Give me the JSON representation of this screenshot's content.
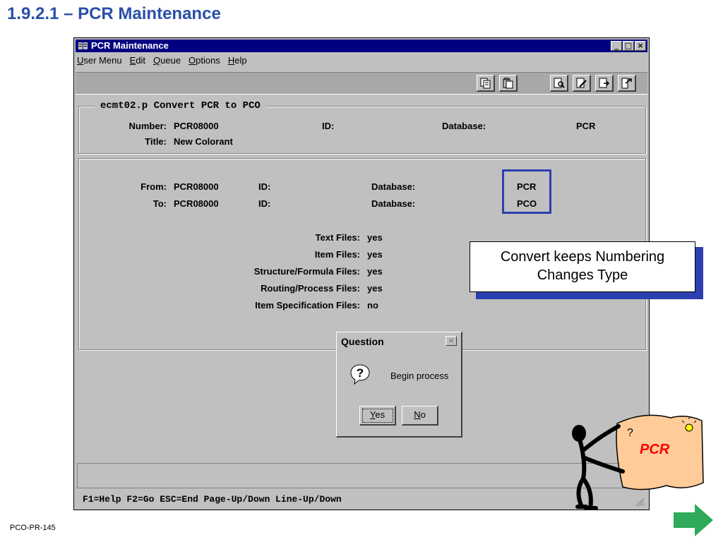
{
  "slide": {
    "title": "1.9.2.1 – PCR Maintenance",
    "footer_code": "PCO-PR-145"
  },
  "window": {
    "title": "PCR Maintenance",
    "menu": [
      {
        "pre": "",
        "key": "U",
        "post": "ser Menu"
      },
      {
        "pre": "",
        "key": "E",
        "post": "dit"
      },
      {
        "pre": "",
        "key": "Q",
        "post": "ueue"
      },
      {
        "pre": "",
        "key": "O",
        "post": "ptions"
      },
      {
        "pre": "",
        "key": "H",
        "post": "elp"
      }
    ],
    "min_glyph": "_",
    "max_glyph": "□",
    "close_glyph": "×"
  },
  "header_group": {
    "caption": "ecmt02.p  Convert PCR to PCO",
    "number_label": "Number:",
    "number_value": "PCR08000",
    "id_label": "ID:",
    "database_label": "Database:",
    "database_value": "PCR",
    "title_label": "Title:",
    "title_value": "New Colorant"
  },
  "convert_group": {
    "from_label": "From:",
    "from_number": "PCR08000",
    "from_id_label": "ID:",
    "from_db_label": "Database:",
    "from_db_value": "PCR",
    "to_label": "To:",
    "to_number": "PCR08000",
    "to_id_label": "ID:",
    "to_db_label": "Database:",
    "to_db_value": "PCO",
    "files": [
      {
        "label": "Text Files:",
        "value": "yes"
      },
      {
        "label": "Item Files:",
        "value": "yes"
      },
      {
        "label": "Structure/Formula Files:",
        "value": "yes"
      },
      {
        "label": "Routing/Process Files:",
        "value": "yes"
      },
      {
        "label": "Item Specification Files:",
        "value": "no"
      }
    ]
  },
  "status_bar": {
    "fkeys": "F1=Help  F2=Go  ESC=End  Page-Up/Down  Line-Up/Down"
  },
  "dialog": {
    "title": "Question",
    "close_glyph": "×",
    "message": "Begin process",
    "yes_key": "Y",
    "yes_rest": "es",
    "no_key": "N",
    "no_rest": "o"
  },
  "callout": {
    "line1": "Convert keeps Numbering",
    "line2": "Changes Type"
  },
  "mascot": {
    "sign_text": "PCR",
    "sign_color": "#ffcc99",
    "text_color": "#ff0000"
  },
  "colors": {
    "title_blue": "#2a4fa8",
    "highlight_blue": "#2c3fb0",
    "arrow_green": "#2eaa5a"
  }
}
